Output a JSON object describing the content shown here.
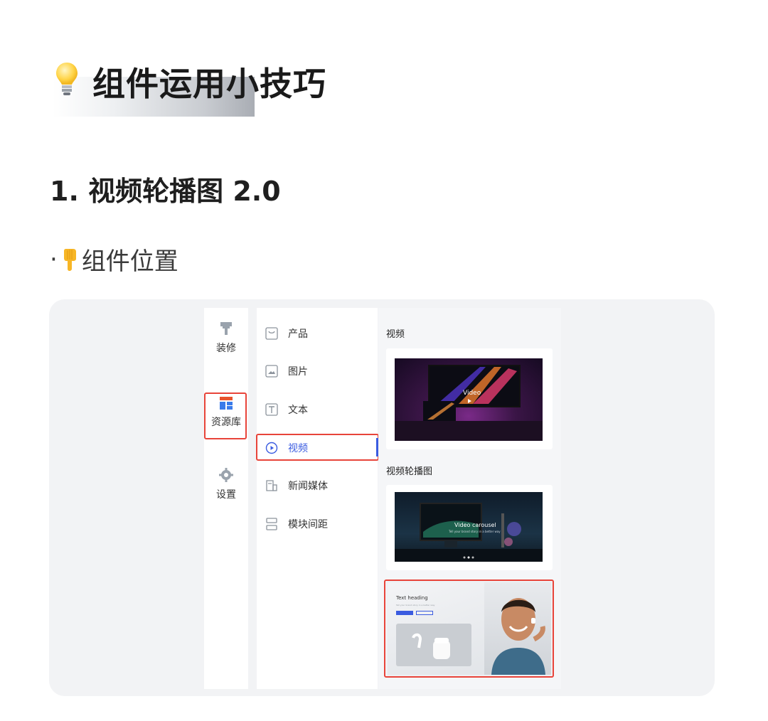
{
  "header": {
    "title": "组件运用小技巧",
    "title_icon": "lightbulb-icon"
  },
  "section": {
    "heading": "1. 视频轮播图 2.0",
    "bullet_prefix": "·",
    "bullet_icon": "pointing-down-hand-icon",
    "bullet_text": "组件位置"
  },
  "rail": {
    "items": [
      {
        "label": "装修",
        "icon": "paint-roller-icon"
      },
      {
        "label": "资源库",
        "icon": "layout-icon"
      },
      {
        "label": "设置",
        "icon": "gear-icon"
      }
    ]
  },
  "menu": {
    "items": [
      {
        "label": "产品",
        "icon": "product-icon"
      },
      {
        "label": "图片",
        "icon": "image-icon"
      },
      {
        "label": "文本",
        "icon": "text-icon"
      },
      {
        "label": "视频",
        "icon": "play-circle-icon",
        "active": true
      },
      {
        "label": "新闻媒体",
        "icon": "news-icon"
      },
      {
        "label": "模块间距",
        "icon": "spacing-icon"
      }
    ]
  },
  "content": {
    "section_video": "视频",
    "section_carousel": "视频轮播图",
    "thumb1_caption": "Video",
    "thumb2_caption": "Video carousel",
    "thumb2_sub": "Tell your brand story in a better way",
    "thumb3_heading": "Text heading",
    "thumb3_sub": "Tell your brand story in a better way"
  },
  "colors": {
    "accent": "#3a5be0",
    "highlight": "#e8443a",
    "panel_bg": "#f2f3f5",
    "rail_active": "#e8443a"
  }
}
